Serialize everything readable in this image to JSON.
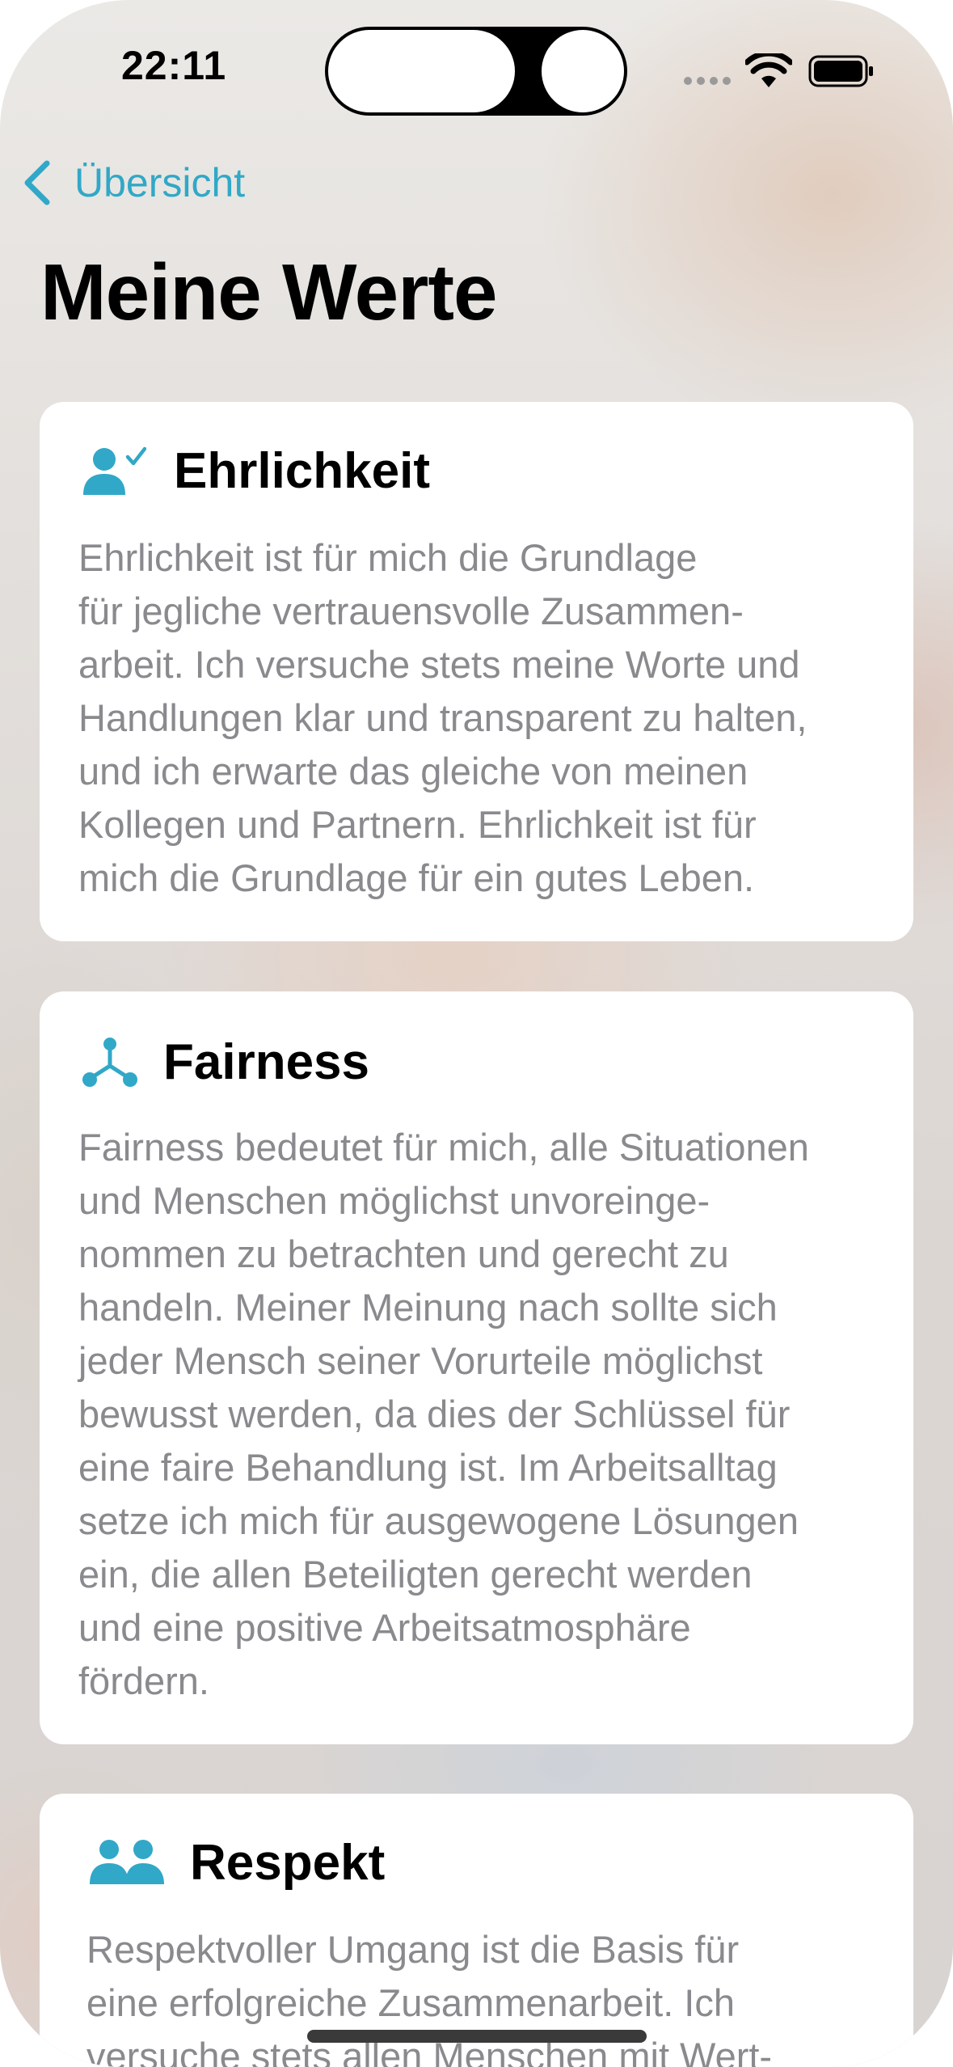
{
  "status_bar": {
    "time": "22:11"
  },
  "nav": {
    "back_label": "Übersicht",
    "title": "Meine Werte"
  },
  "colors": {
    "accent": "#31a8c7",
    "body_text": "#8a8a8e",
    "card_background": "#ffffff"
  },
  "values": [
    {
      "icon": "person-checkmark-icon",
      "title": "Ehrlichkeit",
      "text": "Ehrlichkeit ist für mich die Grundlage\nfür jegliche vertrauensvolle Zusammen-\narbeit. Ich versuche stets meine Worte und\nHandlungen klar und transparent zu halten,\nund ich erwarte das gleiche von meinen\nKollegen und Partnern. Ehrlichkeit ist für\nmich die Grundlage für ein gutes Leben."
    },
    {
      "icon": "network-nodes-icon",
      "title": "Fairness",
      "text": "Fairness bedeutet für mich, alle Situationen\nund Menschen möglichst unvoreinge-\nnommen zu betrachten und gerecht zu\nhandeln. Meiner Meinung nach sollte sich\njeder Mensch seiner Vorurteile möglichst\nbewusst werden, da dies der Schlüssel für\neine faire Behandlung ist. Im Arbeitsalltag\nsetze ich mich für ausgewogene Lösungen\nein, die allen Beteiligten gerecht werden\nund eine positive Arbeitsatmosphäre\nfördern."
    },
    {
      "icon": "two-people-icon",
      "title": "Respekt",
      "text": "Respektvoller Umgang ist die Basis für\neine erfolgreiche Zusammenarbeit. Ich\nversuche stets allen Menschen mit Wert-"
    }
  ]
}
